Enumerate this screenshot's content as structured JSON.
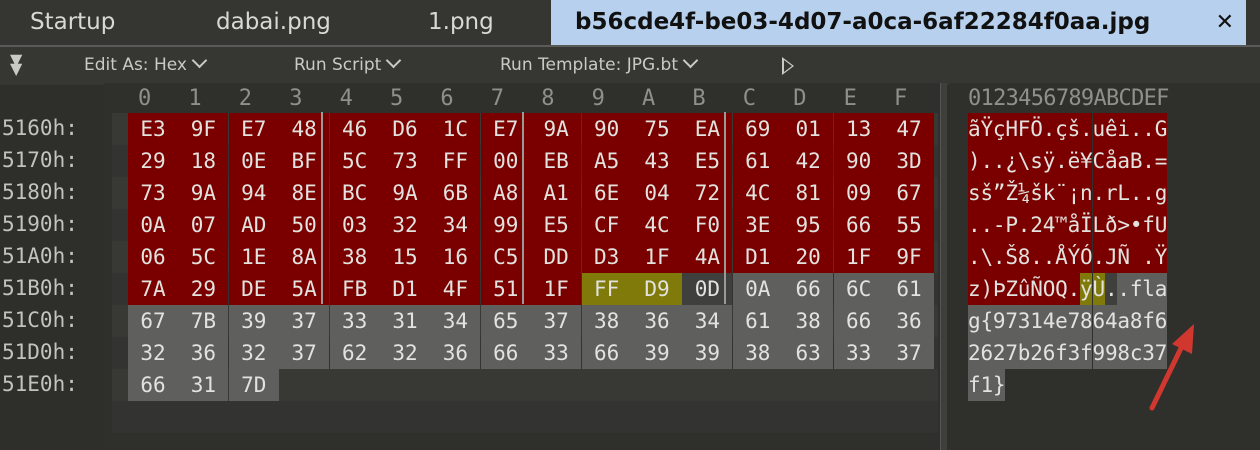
{
  "tabs": [
    {
      "label": "Startup"
    },
    {
      "label": "dabai.png"
    },
    {
      "label": "1.png"
    },
    {
      "label": "b56cde4f-be03-4d07-a0ca-6af22284f0aa.jpg"
    }
  ],
  "tab_close": "✕",
  "toolbar": {
    "edit_as": "Edit As: Hex",
    "run_script": "Run Script",
    "run_template": "Run Template: JPG.bt"
  },
  "hex_columns": [
    "0",
    "1",
    "2",
    "3",
    "4",
    "5",
    "6",
    "7",
    "8",
    "9",
    "A",
    "B",
    "C",
    "D",
    "E",
    "F"
  ],
  "ascii_header": "0123456789ABCDEF",
  "rows": [
    {
      "addr": "5160h:",
      "bytes": [
        "E3",
        "9F",
        "E7",
        "48",
        "46",
        "D6",
        "1C",
        "E7",
        "9A",
        "90",
        "75",
        "EA",
        "69",
        "01",
        "13",
        "47"
      ],
      "ascii": [
        "ã",
        "Ÿ",
        "ç",
        "H",
        "F",
        "Ö",
        ".",
        "ç",
        "š",
        ".",
        "u",
        "ê",
        "i",
        ".",
        ".",
        "G"
      ]
    },
    {
      "addr": "5170h:",
      "bytes": [
        "29",
        "18",
        "0E",
        "BF",
        "5C",
        "73",
        "FF",
        "00",
        "EB",
        "A5",
        "43",
        "E5",
        "61",
        "42",
        "90",
        "3D"
      ],
      "ascii": [
        ")",
        ".",
        ".",
        "¿",
        "\\",
        "s",
        "ÿ",
        ".",
        "ë",
        "¥",
        "C",
        "å",
        "a",
        "B",
        ".",
        "="
      ]
    },
    {
      "addr": "5180h:",
      "bytes": [
        "73",
        "9A",
        "94",
        "8E",
        "BC",
        "9A",
        "6B",
        "A8",
        "A1",
        "6E",
        "04",
        "72",
        "4C",
        "81",
        "09",
        "67"
      ],
      "ascii": [
        "s",
        "š",
        "”",
        "Ž",
        "¼",
        "š",
        "k",
        "¨",
        "¡",
        "n",
        ".",
        "r",
        "L",
        ".",
        ".",
        "g"
      ]
    },
    {
      "addr": "5190h:",
      "bytes": [
        "0A",
        "07",
        "AD",
        "50",
        "03",
        "32",
        "34",
        "99",
        "E5",
        "CF",
        "4C",
        "F0",
        "3E",
        "95",
        "66",
        "55"
      ],
      "ascii": [
        ".",
        ".",
        "-",
        "P",
        ".",
        "2",
        "4",
        "™",
        "å",
        "Ï",
        "L",
        "ð",
        ">",
        "•",
        "f",
        "U"
      ]
    },
    {
      "addr": "51A0h:",
      "bytes": [
        "06",
        "5C",
        "1E",
        "8A",
        "38",
        "15",
        "16",
        "C5",
        "DD",
        "D3",
        "1F",
        "4A",
        "D1",
        "20",
        "1F",
        "9F"
      ],
      "ascii": [
        ".",
        "\\",
        ".",
        "Š",
        "8",
        ".",
        ".",
        "Å",
        "Ý",
        "Ó",
        ".",
        "J",
        "Ñ",
        " ",
        ".",
        "Ÿ"
      ]
    },
    {
      "addr": "51B0h:",
      "bytes": [
        "7A",
        "29",
        "DE",
        "5A",
        "FB",
        "D1",
        "4F",
        "51",
        "1F",
        "FF",
        "D9",
        "0D",
        "0A",
        "66",
        "6C",
        "61"
      ],
      "ascii": [
        "z",
        ")",
        "Þ",
        "Z",
        "û",
        "Ñ",
        "O",
        "Q",
        ".",
        "ÿ",
        "Ù",
        ".",
        ".",
        "f",
        "l",
        "a"
      ]
    },
    {
      "addr": "51C0h:",
      "bytes": [
        "67",
        "7B",
        "39",
        "37",
        "33",
        "31",
        "34",
        "65",
        "37",
        "38",
        "36",
        "34",
        "61",
        "38",
        "66",
        "36"
      ],
      "ascii": [
        "g",
        "{",
        "9",
        "7",
        "3",
        "1",
        "4",
        "e",
        "7",
        "8",
        "6",
        "4",
        "a",
        "8",
        "f",
        "6"
      ]
    },
    {
      "addr": "51D0h:",
      "bytes": [
        "32",
        "36",
        "32",
        "37",
        "62",
        "32",
        "36",
        "66",
        "33",
        "66",
        "39",
        "39",
        "38",
        "63",
        "33",
        "37"
      ],
      "ascii": [
        "2",
        "6",
        "2",
        "7",
        "b",
        "2",
        "6",
        "f",
        "3",
        "f",
        "9",
        "9",
        "8",
        "c",
        "3",
        "7"
      ]
    },
    {
      "addr": "51E0h:",
      "bytes": [
        "66",
        "31",
        "7D"
      ],
      "ascii": [
        "f",
        "1",
        "}"
      ]
    }
  ],
  "colors": {
    "selection": "#7a0000",
    "marker": "#7f7a0a",
    "flag_bg": "#5f5f5d",
    "arrow": "#d0382f",
    "tab_active": "#b6d0ee"
  }
}
